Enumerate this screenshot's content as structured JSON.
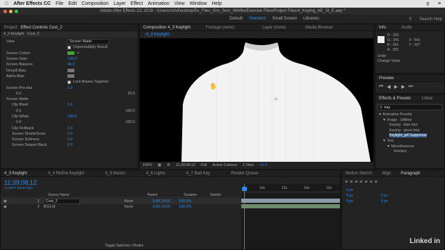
{
  "menu": {
    "app": "After Effects CC",
    "items": [
      "File",
      "Edit",
      "Composition",
      "Layer",
      "Effect",
      "Animation",
      "View",
      "Window",
      "Help"
    ]
  },
  "window_title": "Adobe After Effects CC 2018 - /Users/rich/Desktop/Ex_Files_Grn_Scrn_Wrkflw/Exercise Files/Project Files/4_Keying_AE_St_E.aep *",
  "workspace": {
    "items": [
      "Default",
      "Standard",
      "Small Screen",
      "Libraries"
    ],
    "active": "Standard",
    "search_placeholder": "Search Help"
  },
  "effect_controls": {
    "tabs": [
      "Project",
      "Effect Controls Cost_2"
    ],
    "header": "4_3 Keylight · Cost_2",
    "rows": [
      {
        "k": "View",
        "v": "Screen Matte"
      },
      {
        "k": "",
        "v": "Unpremultiply Result"
      },
      {
        "k": "Screen Colour",
        "v": ""
      },
      {
        "k": "Screen Gain",
        "v": "100.0"
      },
      {
        "k": "Screen Balance",
        "v": "46.2"
      },
      {
        "k": "Despill Bias",
        "v": ""
      },
      {
        "k": "Alpha Bias",
        "v": ""
      },
      {
        "k": "",
        "v": "Lock Biases Together"
      },
      {
        "k": "Screen Pre-blur",
        "v": "1.0"
      },
      {
        "k": "0.0",
        "v": "20.0"
      },
      {
        "k": "Screen Matte",
        "v": ""
      },
      {
        "k": "Clip Black",
        "v": "5.6"
      },
      {
        "k": "0.0",
        "v": "100.0"
      },
      {
        "k": "Clip White",
        "v": "100.0"
      },
      {
        "k": "0.0",
        "v": "100.0"
      },
      {
        "k": "Clip Rollback",
        "v": "0.0"
      },
      {
        "k": "Screen Shrink/Grow",
        "v": "0.0"
      },
      {
        "k": "Screen Softness",
        "v": "0.0"
      },
      {
        "k": "Screen Despot Black",
        "v": "0.0"
      }
    ]
  },
  "viewer": {
    "tabs": [
      "Composition 4_3 Keylight",
      "Footage (none)",
      "Layer (none)",
      "Media Browser"
    ],
    "comp_tab": "4_3 Keylight",
    "footer": {
      "zoom": "100%",
      "timecode": "11;39;08;12",
      "res": "Full",
      "camera": "Active Camera",
      "views": "1 View",
      "offset": "+0.0"
    }
  },
  "info": {
    "tabs": [
      "Info",
      "Audio"
    ],
    "R": "R : 241",
    "G": "G : 241",
    "B": "B : 241",
    "A": "A : 255",
    "X": "X : 541",
    "Y": "Y : 327",
    "undo": "Undo",
    "change": "Change Value"
  },
  "preview": {
    "title": "Preview"
  },
  "effects_presets": {
    "tabs": [
      "Effects & Presets",
      "Librar"
    ],
    "search": "key",
    "items": [
      "Animation Presets",
      "Image - Utilities",
      "Keying - blue blur",
      "Keying - green blur",
      "Keylight_pill Suppresso",
      "Text",
      "Miscellaneous",
      "Smokey"
    ]
  },
  "timeline": {
    "tabs": [
      "4_3 Keylight",
      "4_4 Refine Keylight",
      "4_5 Masks",
      "4_6 Lights",
      "4_7 Bad Key",
      "Render Queue"
    ],
    "timecode": "11;39;08;12",
    "fps": "11;39;07 (29.97 fps)",
    "columns": [
      "Source Name",
      "Parent",
      "Duration",
      "Stretch"
    ],
    "layers": [
      {
        "num": "1",
        "name": "Cost_2",
        "parent": "None",
        "duration": "0;00;15;00",
        "stretch": "100.0%"
      },
      {
        "num": "2",
        "name": "BG3.tif",
        "parent": "None",
        "duration": "0;00;15;00",
        "stretch": "100.0%"
      }
    ],
    "ruler": [
      "10s",
      "12s",
      "14s",
      "16s"
    ],
    "footer": "Toggle Switches / Modes"
  },
  "right_bottom": {
    "tabs": [
      "Motion Sketch",
      "Align",
      "Paragraph"
    ],
    "px_values": [
      "0 px",
      "0 px",
      "0 px",
      "0 px",
      "0 px"
    ]
  },
  "watermark": "Linked in"
}
